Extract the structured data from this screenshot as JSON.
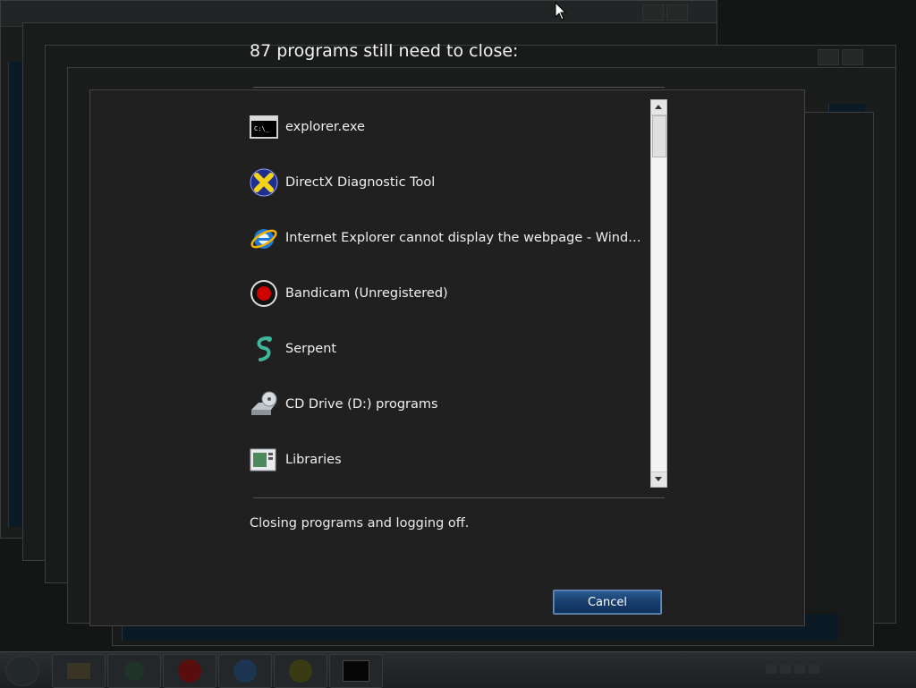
{
  "dialog": {
    "title": "87 programs still need to close:",
    "programs": [
      {
        "label": "explorer.exe",
        "icon": "console-icon"
      },
      {
        "label": "DirectX Diagnostic Tool",
        "icon": "directx-icon"
      },
      {
        "label": "Internet Explorer cannot display the webpage - Window...",
        "icon": "internet-explorer-icon"
      },
      {
        "label": "Bandicam (Unregistered)",
        "icon": "bandicam-record-icon"
      },
      {
        "label": "Serpent",
        "icon": "serpent-icon"
      },
      {
        "label": "CD Drive (D:) programs",
        "icon": "cd-drive-icon"
      },
      {
        "label": "Libraries",
        "icon": "libraries-icon"
      }
    ],
    "status": "Closing programs and logging off.",
    "cancel_label": "Cancel"
  },
  "taskbar": {
    "items": [
      "start-orb-icon",
      "folder-icon",
      "globe-icon",
      "bandicam-record-icon",
      "internet-explorer-icon",
      "directx-icon",
      "console-icon"
    ]
  },
  "colors": {
    "background": "#141616",
    "dialog": "#202020",
    "button_blue": "#173e6d",
    "record_red": "#d10000"
  }
}
